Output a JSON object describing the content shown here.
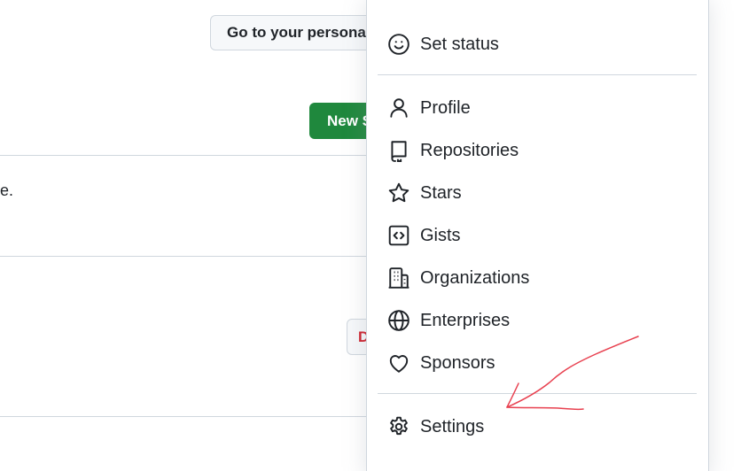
{
  "background": {
    "dashboard_button_label": "Go to your personal profile",
    "new_button_label": "New SSH key",
    "partial_text": "e.",
    "danger_button_label": "Delete"
  },
  "menu": {
    "set_status": "Set status",
    "items": [
      {
        "label": "Profile",
        "icon": "person-icon"
      },
      {
        "label": "Repositories",
        "icon": "repo-icon"
      },
      {
        "label": "Stars",
        "icon": "star-icon"
      },
      {
        "label": "Gists",
        "icon": "code-square-icon"
      },
      {
        "label": "Organizations",
        "icon": "organization-icon"
      },
      {
        "label": "Enterprises",
        "icon": "globe-icon"
      },
      {
        "label": "Sponsors",
        "icon": "heart-icon"
      }
    ],
    "settings": "Settings"
  },
  "colors": {
    "primary_green": "#1f883d",
    "danger_red": "#cf222e",
    "annotation_red": "#e8404f",
    "border": "#d0d7de"
  }
}
